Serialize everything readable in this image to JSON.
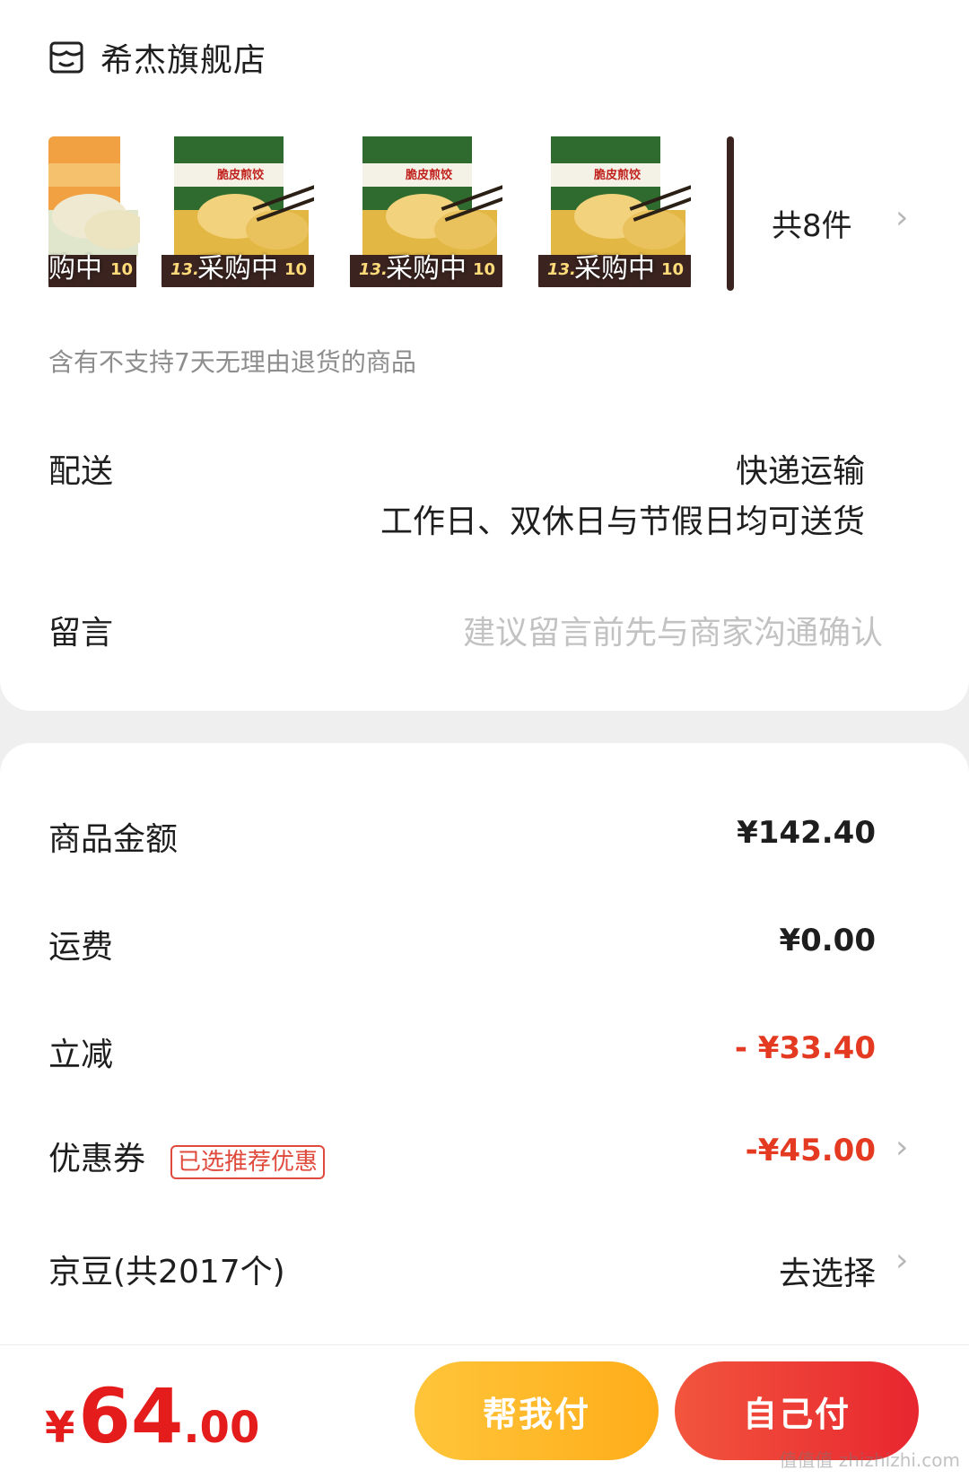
{
  "store": {
    "name": "希杰旗舰店",
    "icon": "store-icon"
  },
  "products": {
    "items": [
      {
        "status": "购中",
        "promo_price": "",
        "promo_badge": "10",
        "package_title": ""
      },
      {
        "status": "采购中",
        "promo_price": "13.",
        "promo_badge": "10",
        "package_title": "脆皮煎饺"
      },
      {
        "status": "采购中",
        "promo_price": "13.",
        "promo_badge": "10",
        "package_title": "脆皮煎饺"
      },
      {
        "status": "采购中",
        "promo_price": "13.",
        "promo_badge": "10",
        "package_title": "脆皮煎饺"
      }
    ],
    "count_label": "共8件"
  },
  "return_note": "含有不支持7天无理由退货的商品",
  "delivery": {
    "label": "配送",
    "method": "快递运输",
    "schedule": "工作日、双休日与节假日均可送货"
  },
  "message": {
    "label": "留言",
    "placeholder": "建议留言前先与商家沟通确认"
  },
  "summary": {
    "goods_label": "商品金额",
    "goods_value": "¥142.40",
    "shipping_label": "运费",
    "shipping_value": "¥0.00",
    "discount_label": "立减",
    "discount_value": "- ¥33.40",
    "coupon_label": "优惠券",
    "coupon_tag": "已选推荐优惠",
    "coupon_value": "-¥45.00",
    "jd_label": "京豆(共2017个)",
    "jd_action": "去选择"
  },
  "footer": {
    "currency": "¥",
    "total_int": "64",
    "total_dec": ".00",
    "help_pay_label": "帮我付",
    "self_pay_label": "自己付"
  },
  "watermark": "值值值 zhizhizhi.com",
  "colors": {
    "accent_red": "#e43a22",
    "help_yellow": "#ffb822",
    "pay_red": "#ea2f31"
  }
}
